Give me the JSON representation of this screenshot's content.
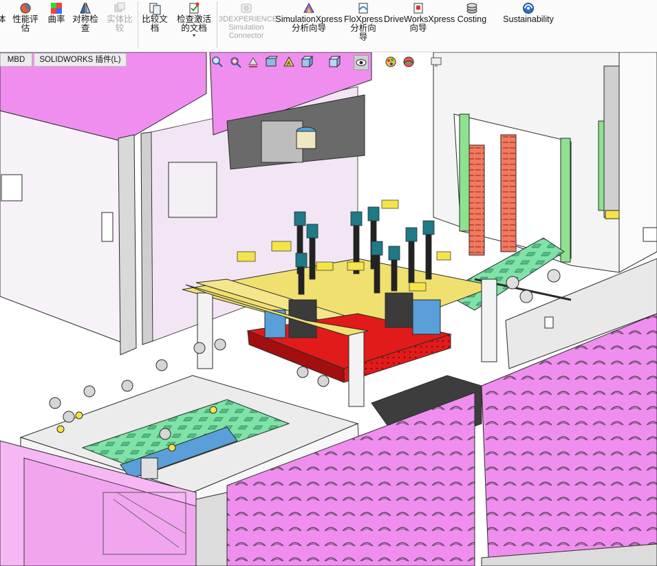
{
  "ribbon": {
    "items": [
      {
        "id": "body",
        "label": "体",
        "icon": "body-icon",
        "enabled": true
      },
      {
        "id": "perf",
        "label": "性能评\n估",
        "icon": "performance-evaluation-icon",
        "enabled": true
      },
      {
        "id": "curvature",
        "label": "曲率",
        "icon": "curvature-icon",
        "enabled": true
      },
      {
        "id": "symmetry",
        "label": "对称检\n查",
        "icon": "symmetry-check-icon",
        "enabled": true
      },
      {
        "id": "compare-body",
        "label": "实体比\n较",
        "icon": "compare-body-icon",
        "enabled": false
      },
      {
        "id": "compare-doc",
        "label": "比较文\n档",
        "icon": "compare-documents-icon",
        "enabled": true
      },
      {
        "id": "check-active",
        "label": "检查激活\n的文档",
        "icon": "check-active-document-icon",
        "enabled": true
      },
      {
        "id": "3dx-sim",
        "label": "3DEXPERIENCE\nSimulation\nConnector",
        "icon": "3dexperience-simulation-icon",
        "enabled": false
      },
      {
        "id": "simxpress",
        "label": "SimulationXpress\n分析向导",
        "icon": "simulationxpress-icon",
        "enabled": true
      },
      {
        "id": "floxpress",
        "label": "FloXpress\n分析向\n导",
        "icon": "floxpress-icon",
        "enabled": true
      },
      {
        "id": "driveworks",
        "label": "DriveWorksXpress\n向导",
        "icon": "driveworksxpress-icon",
        "enabled": true
      },
      {
        "id": "costing",
        "label": "Costing",
        "icon": "costing-icon",
        "enabled": true
      },
      {
        "id": "sustain",
        "label": "Sustainability",
        "icon": "sustainability-icon",
        "enabled": true
      }
    ]
  },
  "tabs": [
    {
      "label": "MBD"
    },
    {
      "label": "SOLIDWORKS 插件(L)"
    }
  ],
  "colors": {
    "pink_panel": "#f08ef0",
    "pink_light": "#f6b8f4",
    "lilac_wall": "#f2e6f4",
    "grey_frame": "#e6e6e6",
    "red_plate": "#e11a1a",
    "green_pcb": "#7fe3a8",
    "yellow_plate": "#f0e070",
    "blue_part": "#5a9fd8",
    "teal_cyl": "#1d7a86",
    "outline": "#2a2a2a"
  },
  "heads_up_toolbar": [
    "zoom-to-fit-icon",
    "zoom-area-icon",
    "previous-view-icon",
    "section-view-icon",
    "dynamic-annotation-icon",
    "view-orientation-icon",
    "display-style-icon",
    "hide-show-icon",
    "edit-appearance-icon",
    "apply-scene-icon",
    "view-settings-icon"
  ]
}
